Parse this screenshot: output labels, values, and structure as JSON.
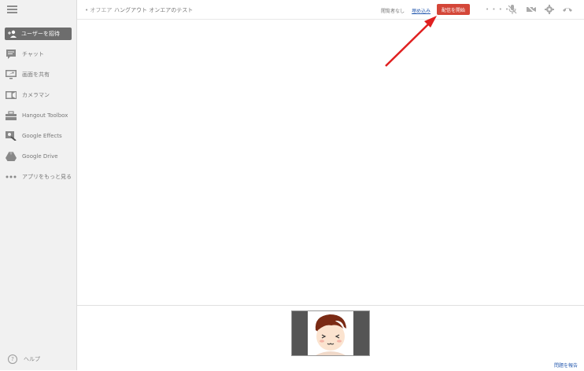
{
  "sidebar": {
    "invite_label": "ユーザーを招待",
    "items": [
      {
        "label": "チャット",
        "icon": "chat-icon"
      },
      {
        "label": "画面を共有",
        "icon": "screenshare-icon"
      },
      {
        "label": "カメラマン",
        "icon": "cameraman-icon"
      },
      {
        "label": "Hangout Toolbox",
        "icon": "toolbox-icon"
      },
      {
        "label": "Google Effects",
        "icon": "effects-icon"
      },
      {
        "label": "Google Drive",
        "icon": "drive-icon"
      },
      {
        "label": "アプリをもっと見る",
        "icon": "more-apps-icon"
      }
    ],
    "help_label": "ヘルプ"
  },
  "topbar": {
    "status": "• オフエア",
    "title": "ハングアウト オンエアのテスト",
    "viewers_label": "閲覧者なし",
    "embed_label": "埋め込み",
    "start_label": "配信を開始",
    "dots": "• • • • •"
  },
  "footer": {
    "report_label": "問題を報告"
  },
  "colors": {
    "start_button": "#d44638",
    "invite_button": "#6d6d6d",
    "link": "#2a5db0",
    "arrow": "#e02020"
  }
}
